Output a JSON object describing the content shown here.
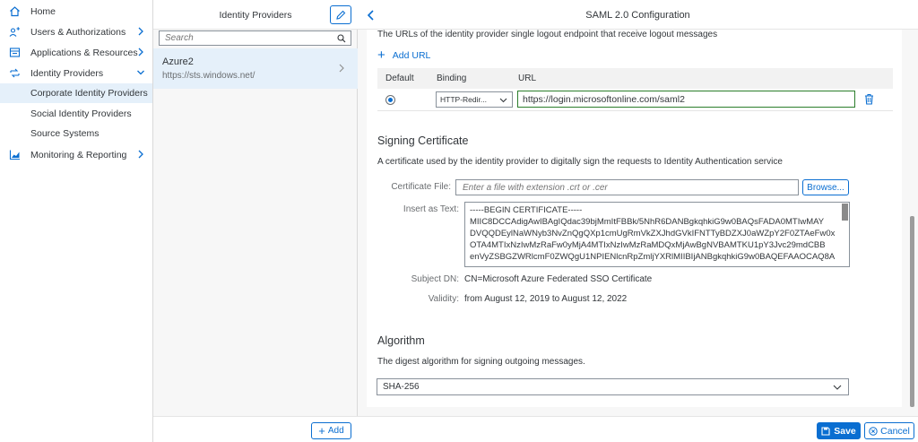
{
  "nav": {
    "home": "Home",
    "users": "Users & Authorizations",
    "applications": "Applications & Resources",
    "identity_providers": "Identity Providers",
    "sub_items": [
      "Corporate Identity Providers",
      "Social Identity Providers",
      "Source Systems"
    ],
    "monitoring": "Monitoring & Reporting"
  },
  "master": {
    "title": "Identity Providers",
    "search_placeholder": "Search",
    "item": {
      "name": "Azure2",
      "url": "https://sts.windows.net/"
    },
    "add_label": "Add"
  },
  "detail": {
    "title": "SAML 2.0 Configuration",
    "logout_desc": "The URLs of the identity provider single logout endpoint that receive logout messages",
    "add_url_label": "Add URL",
    "table": {
      "headers": [
        "Default",
        "Binding",
        "URL"
      ],
      "row": {
        "binding": "HTTP-Redir...",
        "url": "https://login.microsoftonline.com/saml2"
      }
    },
    "signing": {
      "title": "Signing Certificate",
      "desc": "A certificate used by the identity provider to digitally sign the requests to Identity Authentication service",
      "cert_file_label": "Certificate File:",
      "cert_file_placeholder": "Enter a file with extension .crt or .cer",
      "browse_label": "Browse...",
      "insert_text_label": "Insert as Text:",
      "cert_lines": [
        "-----BEGIN CERTIFICATE-----",
        "MIIC8DCCAdigAwIBAgIQdac39bjMmItFBBk/5NhR6DANBgkqhkiG9w0BAQsFADA0MTIwMAY",
        "DVQQDEylNaWNyb3NvZnQgQXp1cmUgRmVkZXJhdGVkIFNTTyBDZXJ0aWZpY2F0ZTAeFw0x",
        "OTA4MTIxNzIwMzRaFw0yMjA4MTIxNzIwMzRaMDQxMjAwBgNVBAMTKU1pY3Jvc29mdCBB",
        "enVyZSBGZWRlcmF0ZWQgU1NPIENlcnRpZmljYXRlMIIBIjANBgkqhkiG9w0BAQEFAAOCAQ8A"
      ],
      "subject_dn_label": "Subject DN:",
      "subject_dn": "CN=Microsoft Azure Federated SSO Certificate",
      "validity_label": "Validity:",
      "validity": "from August 12, 2019 to August 12, 2022"
    },
    "algorithm": {
      "title": "Algorithm",
      "desc": "The digest algorithm for signing outgoing messages.",
      "value": "SHA-256"
    },
    "save_label": "Save",
    "cancel_label": "Cancel"
  },
  "colors": {
    "accent": "#0a6ed1",
    "selected_bg": "#e5f0fa",
    "valid_border": "#2b7d2b"
  }
}
